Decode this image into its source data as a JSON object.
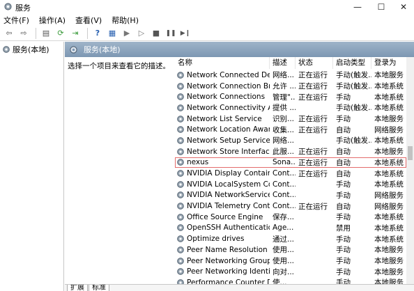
{
  "window": {
    "title": "服务",
    "controls": {
      "minimize": "—",
      "maximize": "☐",
      "close": "✕"
    }
  },
  "menu": [
    {
      "label": "文件(F)"
    },
    {
      "label": "操作(A)"
    },
    {
      "label": "查看(V)"
    },
    {
      "label": "帮助(H)"
    }
  ],
  "toolbar": [
    {
      "icon": "back-arrow-icon",
      "glyph": "⇦"
    },
    {
      "icon": "forward-arrow-icon",
      "glyph": "⇨"
    },
    {
      "icon": "console-tree-icon",
      "glyph": "▤"
    },
    {
      "icon": "refresh-icon",
      "glyph": "⟳"
    },
    {
      "icon": "export-icon",
      "glyph": "⇥"
    },
    {
      "icon": "help-icon",
      "glyph": "?"
    },
    {
      "icon": "properties-icon",
      "glyph": "▦"
    },
    {
      "icon": "start-icon",
      "glyph": "▶"
    },
    {
      "icon": "pause-icon-light",
      "glyph": "▷"
    },
    {
      "icon": "stop-icon",
      "glyph": "■"
    },
    {
      "icon": "pause-icon",
      "glyph": "❚❚"
    },
    {
      "icon": "restart-icon",
      "glyph": "▶❙"
    }
  ],
  "tree": {
    "root_label": "服务(本地)"
  },
  "pane": {
    "header": "服务(本地)",
    "description_prompt": "选择一个项目来查看它的描述。"
  },
  "table": {
    "columns": [
      "名称",
      "描述",
      "状态",
      "启动类型",
      "登录为"
    ],
    "rows": [
      {
        "name": "Network Connected Devic...",
        "desc": "网络...",
        "status": "正在运行",
        "start": "手动(触发...",
        "logon": "本地服务"
      },
      {
        "name": "Network Connection Broker",
        "desc": "允许 ...",
        "status": "正在运行",
        "start": "手动(触发...",
        "logon": "本地系统"
      },
      {
        "name": "Network Connections",
        "desc": "管理\"...",
        "status": "正在运行",
        "start": "手动",
        "logon": "本地系统"
      },
      {
        "name": "Network Connectivity Assis...",
        "desc": "提供 ...",
        "status": "",
        "start": "手动(触发...",
        "logon": "本地系统"
      },
      {
        "name": "Network List Service",
        "desc": "识别...",
        "status": "正在运行",
        "start": "手动",
        "logon": "本地服务"
      },
      {
        "name": "Network Location Awarene...",
        "desc": "收集...",
        "status": "正在运行",
        "start": "自动",
        "logon": "网络服务"
      },
      {
        "name": "Network Setup Service",
        "desc": "网络...",
        "status": "",
        "start": "手动(触发...",
        "logon": "本地系统"
      },
      {
        "name": "Network Store Interface Se...",
        "desc": "此服...",
        "status": "正在运行",
        "start": "自动",
        "logon": "本地服务"
      },
      {
        "name": "nexus",
        "desc": "Sona...",
        "status": "正在运行",
        "start": "自动",
        "logon": "本地系统",
        "selected": true
      },
      {
        "name": "NVIDIA Display Container LS",
        "desc": "Cont...",
        "status": "正在运行",
        "start": "自动",
        "logon": "本地系统"
      },
      {
        "name": "NVIDIA LocalSystem Conta...",
        "desc": "Cont...",
        "status": "",
        "start": "手动",
        "logon": "本地系统"
      },
      {
        "name": "NVIDIA NetworkService C...",
        "desc": "Cont...",
        "status": "",
        "start": "手动",
        "logon": "网络服务"
      },
      {
        "name": "NVIDIA Telemetry Container",
        "desc": "Cont...",
        "status": "正在运行",
        "start": "自动",
        "logon": "网络服务"
      },
      {
        "name": "Office  Source Engine",
        "desc": "保存...",
        "status": "",
        "start": "手动",
        "logon": "本地系统"
      },
      {
        "name": "OpenSSH Authentication ...",
        "desc": "Age...",
        "status": "",
        "start": "禁用",
        "logon": "本地系统"
      },
      {
        "name": "Optimize drives",
        "desc": "通过...",
        "status": "",
        "start": "手动",
        "logon": "本地系统"
      },
      {
        "name": "Peer Name Resolution Pro...",
        "desc": "使用...",
        "status": "",
        "start": "手动",
        "logon": "本地服务"
      },
      {
        "name": "Peer Networking Grouping",
        "desc": "使用...",
        "status": "",
        "start": "手动",
        "logon": "本地服务"
      },
      {
        "name": "Peer Networking Identity ...",
        "desc": "向对...",
        "status": "",
        "start": "手动",
        "logon": "本地服务"
      },
      {
        "name": "Performance Counter DLL ...",
        "desc": "使...",
        "status": "",
        "start": "手动",
        "logon": "本地服务"
      }
    ]
  },
  "tabs": [
    {
      "label": "扩展"
    },
    {
      "label": "标准"
    }
  ]
}
